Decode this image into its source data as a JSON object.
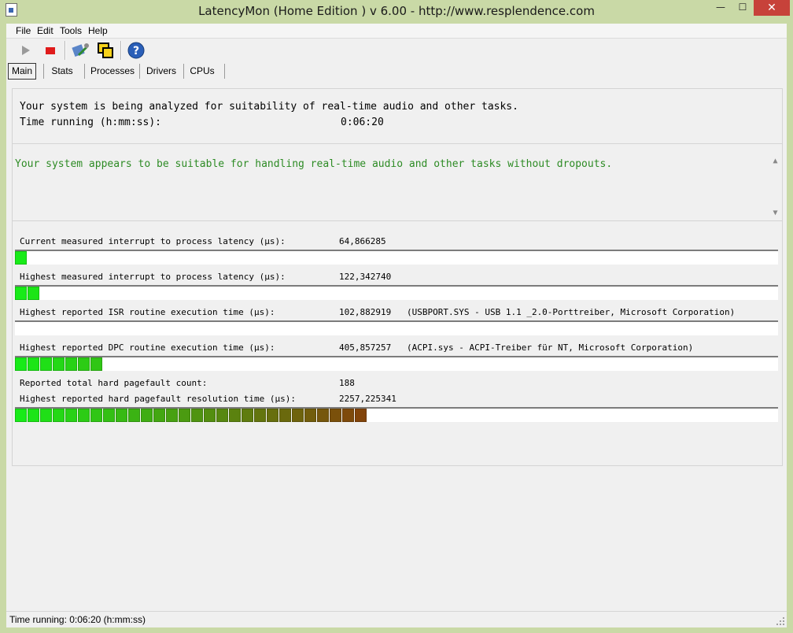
{
  "window": {
    "title": "LatencyMon  (Home Edition )  v 6.00 - http://www.resplendence.com",
    "minimize": "—",
    "maximize": "☐",
    "close": "✕"
  },
  "menu": [
    {
      "label": "File"
    },
    {
      "label": "Edit"
    },
    {
      "label": "Tools"
    },
    {
      "label": "Help"
    }
  ],
  "toolbar": {
    "icons": [
      "play-icon",
      "stop-icon",
      "wrench-icon",
      "windows-icon",
      "help-icon"
    ]
  },
  "tabs": [
    {
      "label": "Main",
      "active": true
    },
    {
      "label": "Stats",
      "active": false
    },
    {
      "label": "Processes",
      "active": false
    },
    {
      "label": "Drivers",
      "active": false
    },
    {
      "label": "CPUs",
      "active": false
    }
  ],
  "summary": {
    "analyzing": "Your system is being analyzed for suitability of real-time audio and other tasks.",
    "time_label": "Time running (h:mm:ss):",
    "time_value": "0:06:20"
  },
  "verdict": {
    "text": "Your system appears to be suitable for handling real-time audio and other tasks without dropouts.",
    "color": "#2d8b24"
  },
  "metrics": [
    {
      "label": "Current measured interrupt to process latency (µs):",
      "value": "64,866285",
      "extra": "",
      "bar_segments": 1
    },
    {
      "label": "Highest measured interrupt to process latency (µs):",
      "value": "122,342740",
      "extra": "",
      "bar_segments": 2
    },
    {
      "label": "Highest reported ISR routine execution time (µs):",
      "value": "102,882919",
      "extra": "(USBPORT.SYS - USB 1.1 _2.0-Porttreiber, Microsoft Corporation)",
      "bar_segments": 0
    },
    {
      "label": "Highest reported DPC routine execution time (µs):",
      "value": "405,857257",
      "extra": "(ACPI.sys - ACPI-Treiber für NT, Microsoft Corporation)",
      "bar_segments": 7
    },
    {
      "label": "Reported total hard pagefault count:",
      "value": "188",
      "extra": ""
    },
    {
      "label": "Highest reported hard pagefault resolution time (µs):",
      "value": "2257,225341",
      "extra": "",
      "bar_segments": 28
    }
  ],
  "status": {
    "text": "Time running: 0:06:20  (h:mm:ss)"
  }
}
